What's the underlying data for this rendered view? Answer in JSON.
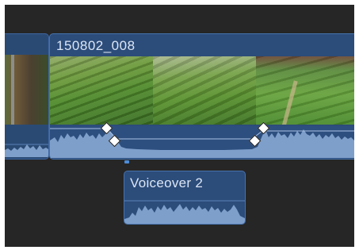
{
  "timeline": {
    "main_clip": {
      "name": "150802_008"
    },
    "voice_clip": {
      "name": "Voiceover 2"
    },
    "keyframe_count": 4
  },
  "colors": {
    "background": "#262626",
    "clip_fill": "#2c4c7a",
    "clip_border": "#4672ad",
    "waveform": "#7f9fcb",
    "playhead_marker": "#4d8cd8"
  }
}
